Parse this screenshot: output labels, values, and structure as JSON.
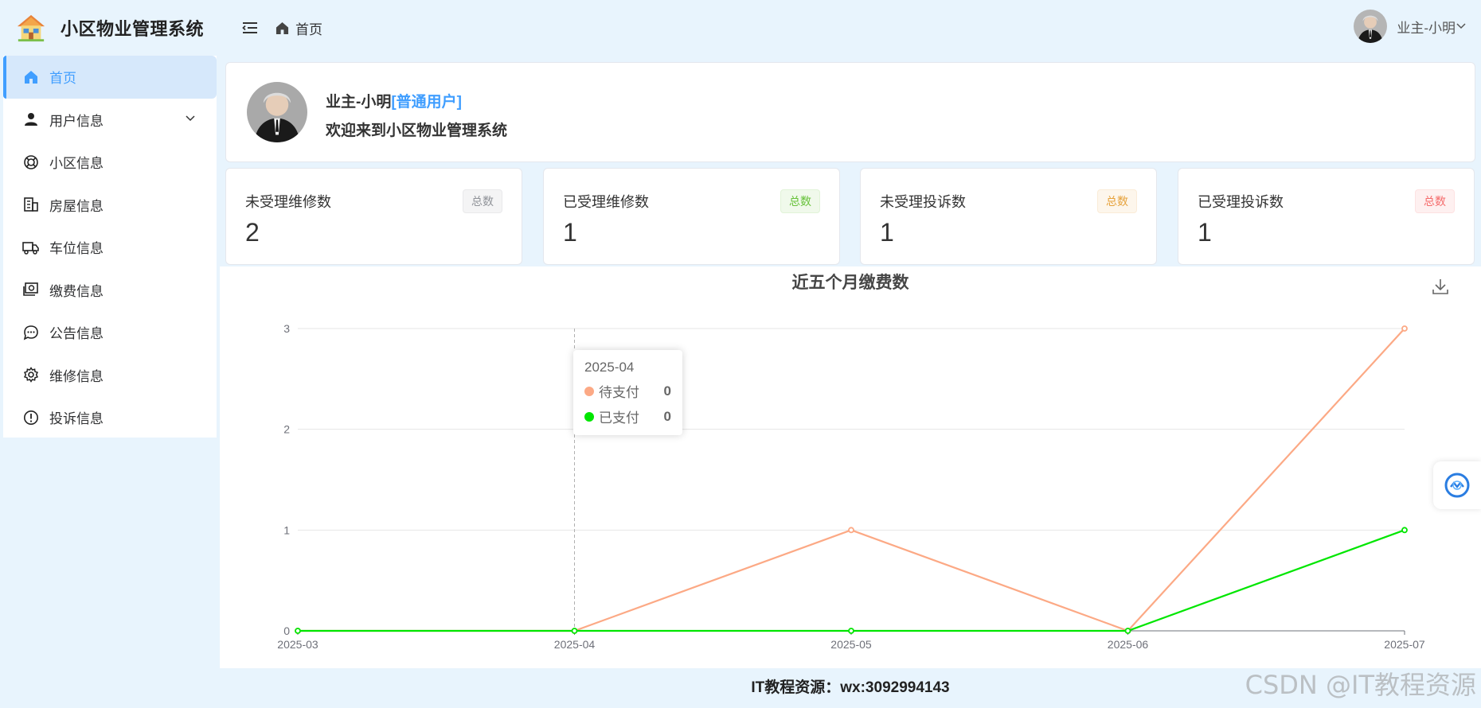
{
  "app": {
    "title": "小区物业管理系统"
  },
  "sidebar": {
    "items": [
      {
        "label": "首页",
        "icon": "home-icon"
      },
      {
        "label": "用户信息",
        "icon": "user-icon"
      },
      {
        "label": "小区信息",
        "icon": "community-icon"
      },
      {
        "label": "房屋信息",
        "icon": "building-icon"
      },
      {
        "label": "车位信息",
        "icon": "truck-icon"
      },
      {
        "label": "缴费信息",
        "icon": "payment-icon"
      },
      {
        "label": "公告信息",
        "icon": "chat-icon"
      },
      {
        "label": "维修信息",
        "icon": "gear-icon"
      },
      {
        "label": "投诉信息",
        "icon": "warning-icon"
      }
    ]
  },
  "header": {
    "breadcrumb": "首页",
    "username": "业主-小明"
  },
  "welcome": {
    "name": "业主-小明",
    "role": "[普通用户]",
    "message": "欢迎来到小区物业管理系统"
  },
  "stats": [
    {
      "title": "未受理维修数",
      "value": "2",
      "tag": "总数"
    },
    {
      "title": "已受理维修数",
      "value": "1",
      "tag": "总数"
    },
    {
      "title": "未受理投诉数",
      "value": "1",
      "tag": "总数"
    },
    {
      "title": "已受理投诉数",
      "value": "1",
      "tag": "总数"
    }
  ],
  "chart_data": {
    "type": "line",
    "title": "近五个月缴费数",
    "x": [
      "2025-03",
      "2025-04",
      "2025-05",
      "2025-06",
      "2025-07"
    ],
    "series": [
      {
        "name": "待支付",
        "values": [
          0,
          0,
          1,
          0,
          3
        ],
        "color": "#fca985"
      },
      {
        "name": "已支付",
        "values": [
          0,
          0,
          0,
          0,
          1
        ],
        "color": "#00e600"
      }
    ],
    "ylim": [
      0,
      3
    ],
    "yticks": [
      "0",
      "1",
      "2",
      "3"
    ],
    "grid": true
  },
  "tooltip": {
    "title": "2025-04",
    "rows": [
      {
        "label": "待支付",
        "value": "0",
        "color": "#fca985"
      },
      {
        "label": "已支付",
        "value": "0",
        "color": "#00e600"
      }
    ]
  },
  "footer": {
    "text": "IT教程资源：wx:3092994143"
  },
  "watermark": {
    "text": "CSDN @IT教程资源"
  }
}
